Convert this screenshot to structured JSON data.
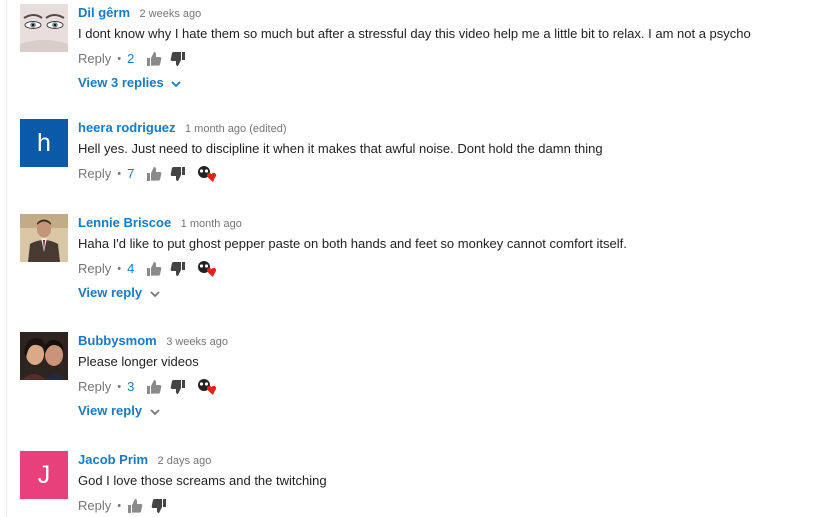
{
  "comments": [
    {
      "author": "Dil gêrm",
      "time": "2 weeks ago",
      "text": "I dont know why I hate them so much but after a stressful day this video help me a little bit to relax. I am not a psycho",
      "reply_label": "Reply",
      "bullet": "•",
      "likes": "2",
      "view_replies": "View 3 replies"
    },
    {
      "author": "heera rodriguez",
      "time": "1 month ago (edited)",
      "avatar_letter": "h",
      "avatar_color": "#0b5aa8",
      "text": "Hell yes.  Just need to discipline it when it makes that awful noise.  Dont hold the damn thing",
      "reply_label": "Reply",
      "bullet": "•",
      "likes": "7"
    },
    {
      "author": "Lennie Briscoe",
      "time": "1 month ago",
      "text": "Haha I'd like to put ghost pepper paste on both hands and feet so monkey cannot comfort itself.",
      "reply_label": "Reply",
      "bullet": "•",
      "likes": "4",
      "view_replies": "View reply"
    },
    {
      "author": "Bubbysmom",
      "time": "3 weeks ago",
      "text": "Please longer videos",
      "reply_label": "Reply",
      "bullet": "•",
      "likes": "3",
      "view_replies": "View reply"
    },
    {
      "author": "Jacob Prim",
      "time": "2 days ago",
      "avatar_letter": "J",
      "avatar_color": "#e8407a",
      "text": "God I love those screams and the twitching",
      "reply_label": "Reply",
      "bullet": "•"
    }
  ],
  "colors": {
    "link": "#167ac6",
    "heart": "#e62117"
  }
}
